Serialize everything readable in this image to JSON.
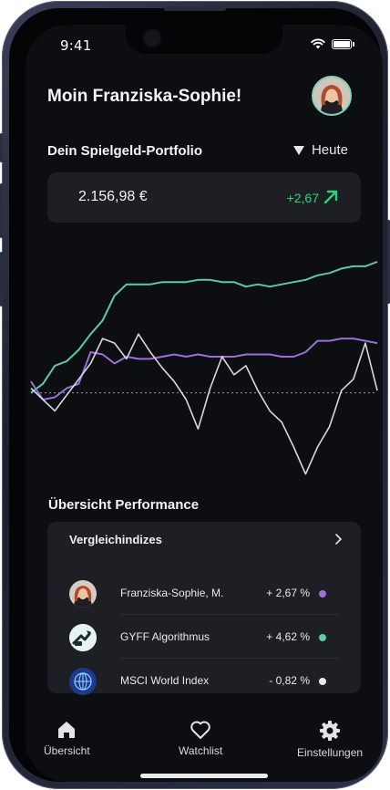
{
  "status_bar": {
    "time": "9:41"
  },
  "header": {
    "greeting": "Moin Franziska-Sophie!"
  },
  "portfolio": {
    "title": "Dein Spielgeld-Portfolio",
    "period_label": "Heute",
    "value": "2.156,98 €",
    "change": "+2,67"
  },
  "chart_data": {
    "type": "line",
    "title": "",
    "xlabel": "",
    "ylabel": "",
    "baseline": 0,
    "ylim": [
      -4.5,
      6
    ],
    "grid": false,
    "series": [
      {
        "color": "#5fc9a6",
        "values": [
          0,
          0.4,
          1.2,
          1.4,
          1.9,
          2.6,
          3.2,
          4.3,
          4.8,
          4.8,
          4.8,
          4.9,
          4.9,
          4.9,
          5.0,
          5.0,
          4.9,
          4.9,
          4.7,
          4.8,
          4.7,
          4.8,
          4.9,
          5.0,
          5.2,
          5.3,
          5.5,
          5.6,
          5.6,
          5.8
        ]
      },
      {
        "color": "#9b6fd8",
        "values": [
          0.5,
          -0.3,
          -0.2,
          0.2,
          0.4,
          1.8,
          1.7,
          1.3,
          1.6,
          1.5,
          1.5,
          1.6,
          1.7,
          1.6,
          1.7,
          1.6,
          1.6,
          1.6,
          1.7,
          1.7,
          1.7,
          1.6,
          1.6,
          1.8,
          2.3,
          2.3,
          2.4,
          2.4,
          2.3,
          2.2
        ]
      },
      {
        "color": "#d8d8dc",
        "values": [
          0.2,
          -0.3,
          -0.8,
          -0.1,
          0.6,
          1.3,
          2.4,
          2.2,
          1.5,
          2.6,
          1.8,
          1.1,
          0.5,
          -0.3,
          -1.6,
          0.2,
          1.6,
          0.8,
          1.2,
          0.1,
          -0.8,
          -1.3,
          -2.4,
          -3.6,
          -2.4,
          -1.5,
          0.1,
          0.6,
          2.2,
          0.1
        ]
      }
    ]
  },
  "performance": {
    "title": "Übersicht Performance",
    "subtitle": "Vergleichindizes",
    "rows": [
      {
        "name": "Franziska-Sophie, M.",
        "pct": "+ 2,67 %",
        "color": "#9b6fd8",
        "icon": "user-avatar-icon"
      },
      {
        "name": "GYFF Algorithmus",
        "pct": "+ 4,62 %",
        "color": "#5fc9a6",
        "icon": "robot-hand-icon"
      },
      {
        "name": "MSCI World Index",
        "pct": "- 0,82 %",
        "color": "#e8e8ec",
        "icon": "globe-icon"
      }
    ]
  },
  "tabs": [
    {
      "label": "Übersicht",
      "icon": "home-icon"
    },
    {
      "label": "Watchlist",
      "icon": "heart-icon"
    },
    {
      "label": "Einstellungen",
      "icon": "gear-icon"
    }
  ]
}
